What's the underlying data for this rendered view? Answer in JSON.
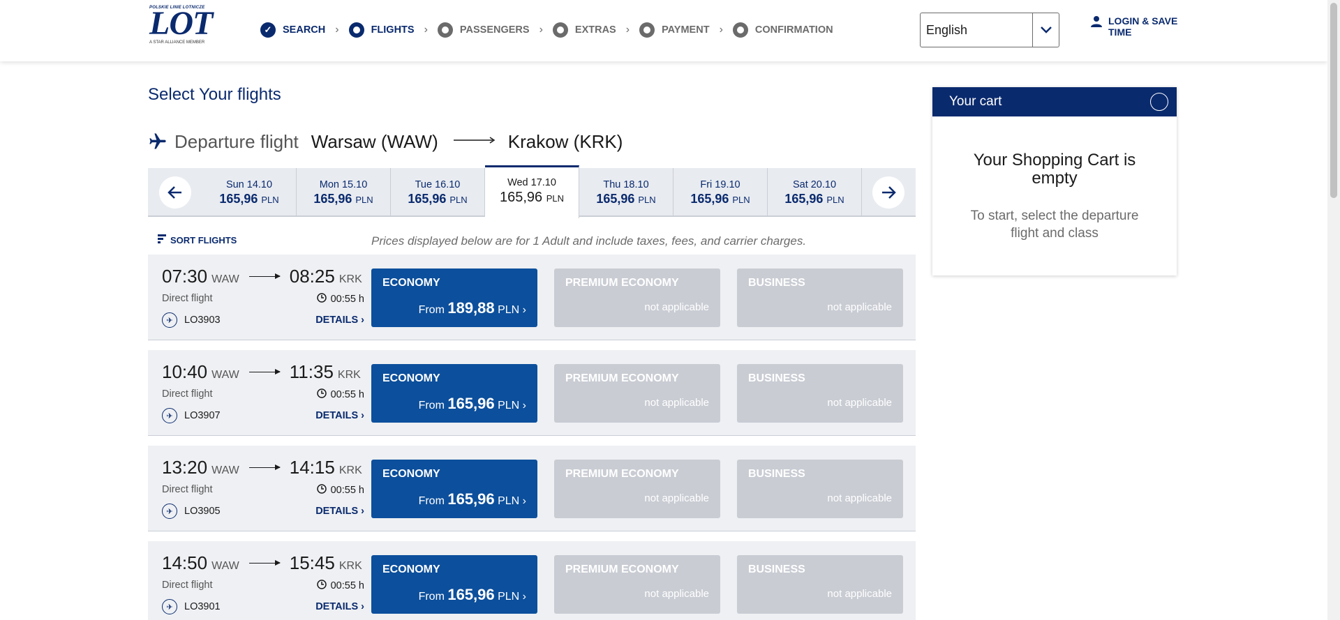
{
  "header": {
    "logo": {
      "tagline": "POLSKIE LINIE LOTNICZE",
      "brand": "LOT",
      "alliance": "A STAR ALLIANCE MEMBER"
    },
    "steps": [
      {
        "label": "SEARCH",
        "state": "done"
      },
      {
        "label": "FLIGHTS",
        "state": "active"
      },
      {
        "label": "PASSENGERS",
        "state": "pending"
      },
      {
        "label": "EXTRAS",
        "state": "pending"
      },
      {
        "label": "PAYMENT",
        "state": "pending"
      },
      {
        "label": "CONFIRMATION",
        "state": "pending"
      }
    ],
    "language": "English",
    "login": "LOGIN & SAVE TIME"
  },
  "main": {
    "title": "Select Your flights",
    "route": {
      "label": "Departure flight",
      "from": "Warsaw (WAW)",
      "to": "Krakow (KRK)"
    },
    "dates": [
      {
        "day": "Sun 14.10",
        "price": "165,96",
        "currency": "PLN"
      },
      {
        "day": "Mon 15.10",
        "price": "165,96",
        "currency": "PLN"
      },
      {
        "day": "Tue 16.10",
        "price": "165,96",
        "currency": "PLN"
      },
      {
        "day": "Wed 17.10",
        "price": "165,96",
        "currency": "PLN"
      },
      {
        "day": "Thu 18.10",
        "price": "165,96",
        "currency": "PLN"
      },
      {
        "day": "Fri 19.10",
        "price": "165,96",
        "currency": "PLN"
      },
      {
        "day": "Sat 20.10",
        "price": "165,96",
        "currency": "PLN"
      }
    ],
    "sort_label": "SORT FLIGHTS",
    "note": "Prices displayed below are for 1 Adult and include taxes, fees, and carrier charges.",
    "flights": [
      {
        "dep": "07:30",
        "dep_code": "WAW",
        "arr": "08:25",
        "arr_code": "KRK",
        "type": "Direct flight",
        "duration": "00:55 h",
        "number": "LO3903",
        "details": "DETAILS",
        "eco_label": "ECONOMY",
        "eco_from": "From",
        "eco_price": "189,88",
        "eco_cur": "PLN",
        "prem_label": "PREMIUM ECONOMY",
        "prem_status": "not applicable",
        "bus_label": "BUSINESS",
        "bus_status": "not applicable"
      },
      {
        "dep": "10:40",
        "dep_code": "WAW",
        "arr": "11:35",
        "arr_code": "KRK",
        "type": "Direct flight",
        "duration": "00:55 h",
        "number": "LO3907",
        "details": "DETAILS",
        "eco_label": "ECONOMY",
        "eco_from": "From",
        "eco_price": "165,96",
        "eco_cur": "PLN",
        "prem_label": "PREMIUM ECONOMY",
        "prem_status": "not applicable",
        "bus_label": "BUSINESS",
        "bus_status": "not applicable"
      },
      {
        "dep": "13:20",
        "dep_code": "WAW",
        "arr": "14:15",
        "arr_code": "KRK",
        "type": "Direct flight",
        "duration": "00:55 h",
        "number": "LO3905",
        "details": "DETAILS",
        "eco_label": "ECONOMY",
        "eco_from": "From",
        "eco_price": "165,96",
        "eco_cur": "PLN",
        "prem_label": "PREMIUM ECONOMY",
        "prem_status": "not applicable",
        "bus_label": "BUSINESS",
        "bus_status": "not applicable"
      },
      {
        "dep": "14:50",
        "dep_code": "WAW",
        "arr": "15:45",
        "arr_code": "KRK",
        "type": "Direct flight",
        "duration": "00:55 h",
        "number": "LO3901",
        "details": "DETAILS",
        "eco_label": "ECONOMY",
        "eco_from": "From",
        "eco_price": "165,96",
        "eco_cur": "PLN",
        "prem_label": "PREMIUM ECONOMY",
        "prem_status": "not applicable",
        "bus_label": "BUSINESS",
        "bus_status": "not applicable"
      }
    ]
  },
  "cart": {
    "title": "Your cart",
    "empty_title": "Your Shopping Cart is empty",
    "empty_sub": "To start, select the departure flight and class"
  },
  "colors": {
    "brand": "#0a2a6e",
    "economy": "#0c4f9c",
    "disabled": "#c9ccd3"
  }
}
